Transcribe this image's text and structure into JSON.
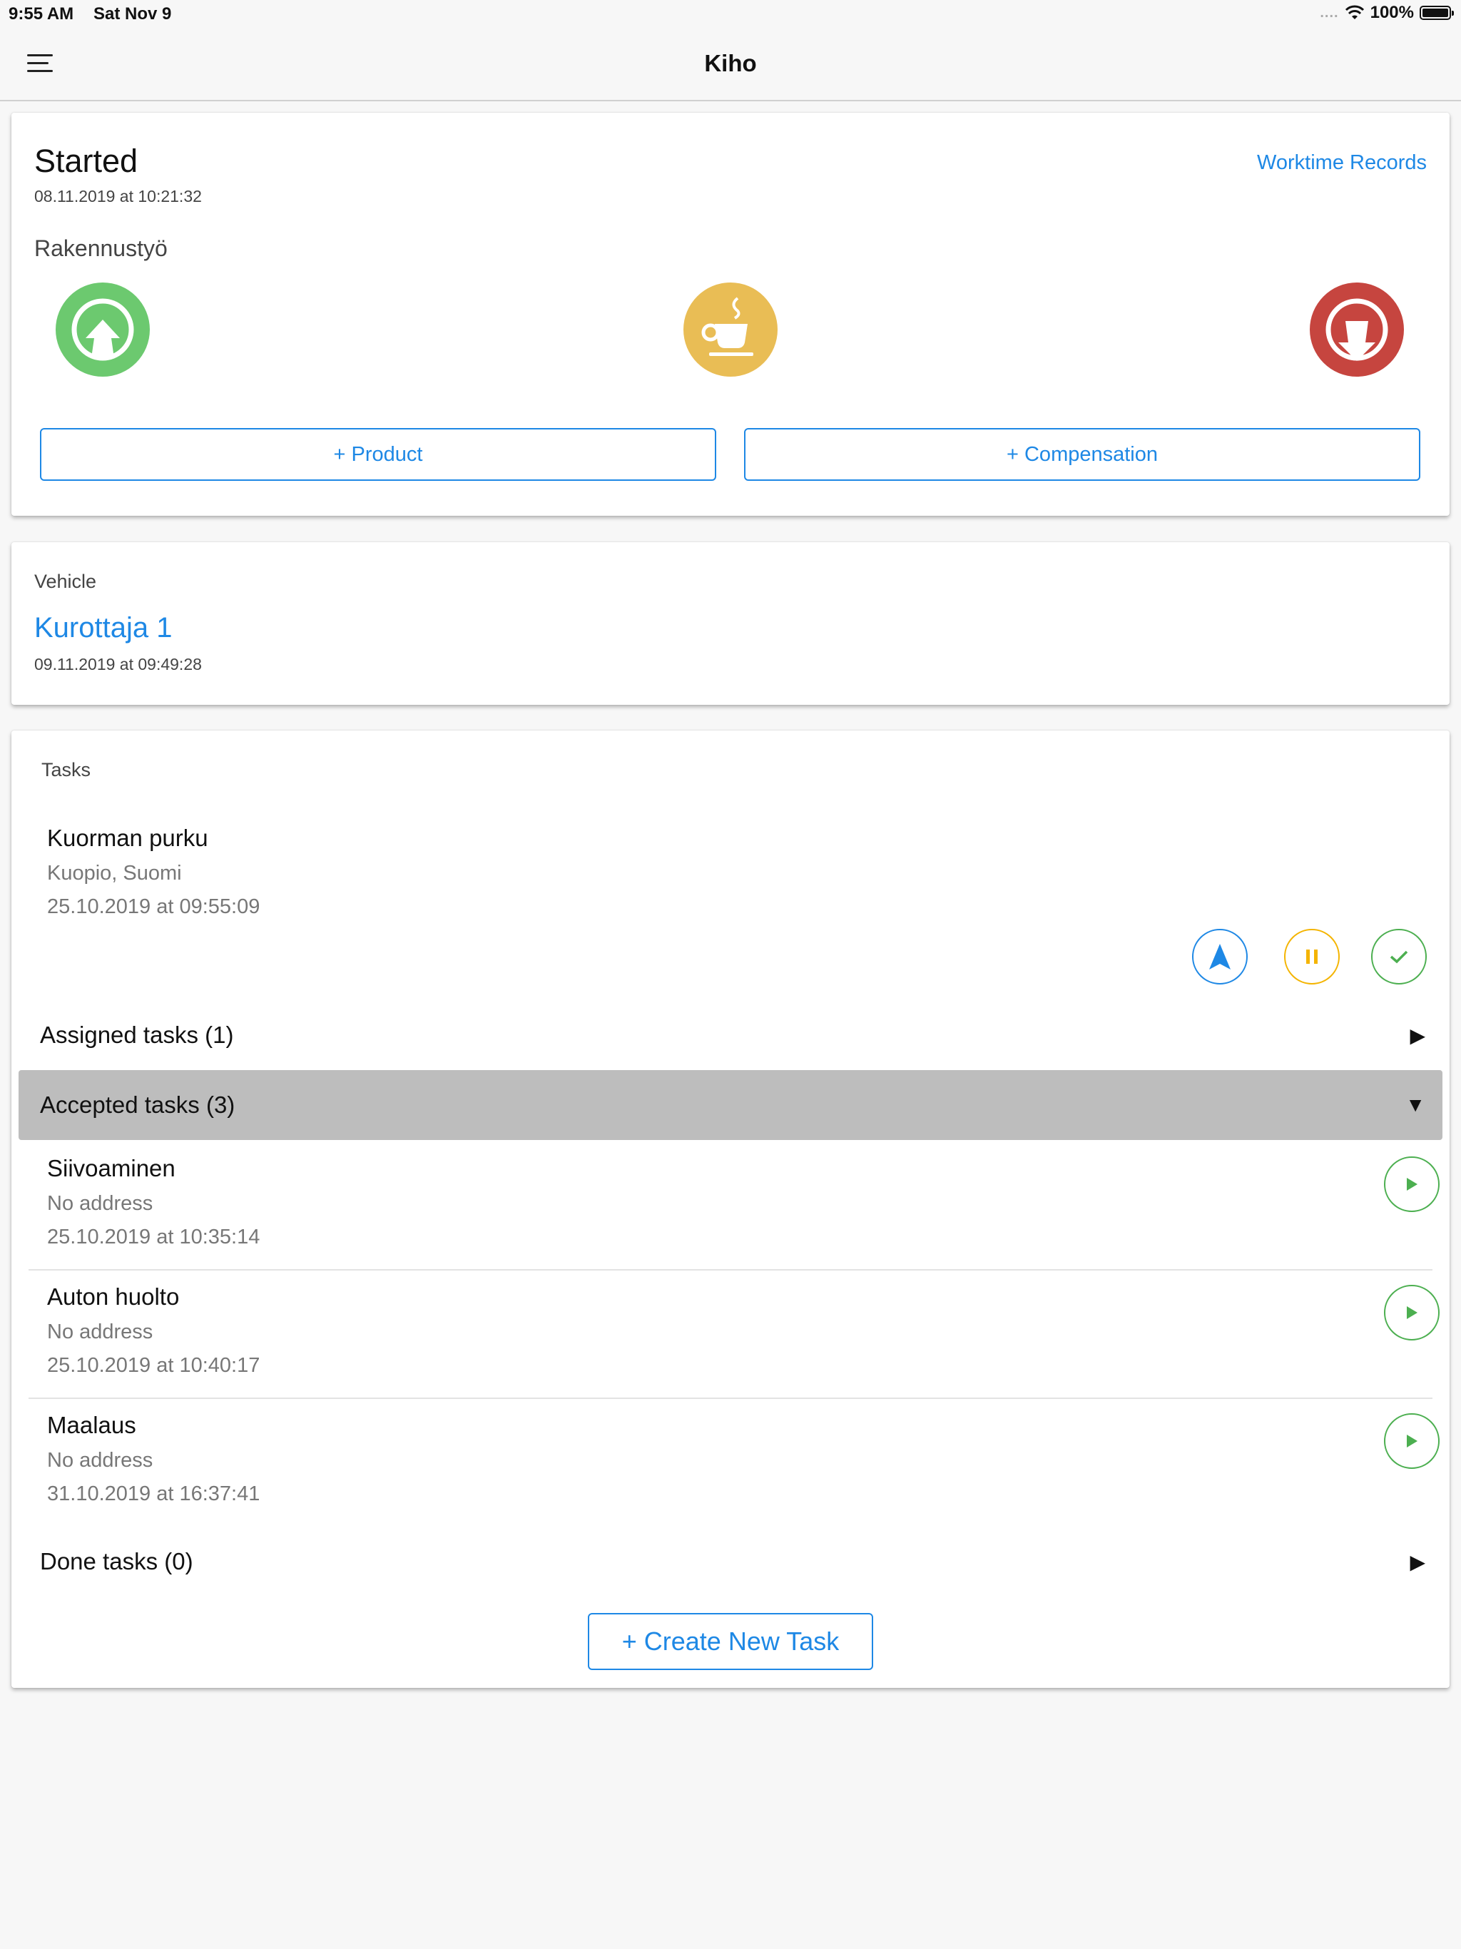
{
  "status_bar": {
    "time": "9:55 AM",
    "date": "Sat Nov 9",
    "signal_dots": "....",
    "battery": "100%",
    "icons": [
      "wifi-icon",
      "battery-icon"
    ]
  },
  "nav": {
    "title": "Kiho",
    "menu_icon": "hamburger-menu-icon"
  },
  "worktime": {
    "state": "Started",
    "started_at": "08.11.2019 at 10:21:32",
    "records_link": "Worktime Records",
    "work_type": "Rakennustyö",
    "buttons": [
      {
        "name": "start-work",
        "icon": "arrow-up-circle-icon",
        "color": "#6cc96f"
      },
      {
        "name": "break",
        "icon": "coffee-cup-icon",
        "color": "#e9bd55"
      },
      {
        "name": "end-work",
        "icon": "arrow-down-circle-icon",
        "color": "#c6453f"
      }
    ],
    "product_label": "+ Product",
    "compensation_label": "+ Compensation"
  },
  "vehicle": {
    "label": "Vehicle",
    "name": "Kurottaja 1",
    "time": "09.11.2019 at 09:49:28"
  },
  "tasks": {
    "label": "Tasks",
    "active": {
      "name": "Kuorman purku",
      "address": "Kuopio, Suomi",
      "time": "25.10.2019 at 09:55:09"
    },
    "assigned_label": "Assigned tasks (1)",
    "accepted_label": "Accepted tasks (3)",
    "accepted": [
      {
        "name": "Siivoaminen",
        "address": "No address",
        "time": "25.10.2019 at 10:35:14"
      },
      {
        "name": "Auton huolto",
        "address": "No address",
        "time": "25.10.2019 at 10:40:17"
      },
      {
        "name": "Maalaus",
        "address": "No address",
        "time": "31.10.2019 at 16:37:41"
      }
    ],
    "done_label": "Done tasks (0)",
    "create_label": "+ Create New Task",
    "arrow_right": "▶",
    "arrow_down": "▼"
  },
  "colors": {
    "accent": "#1e88e5",
    "green": "#4caf50",
    "yellow": "#f4b400",
    "section_bg": "#bdbdbd"
  }
}
